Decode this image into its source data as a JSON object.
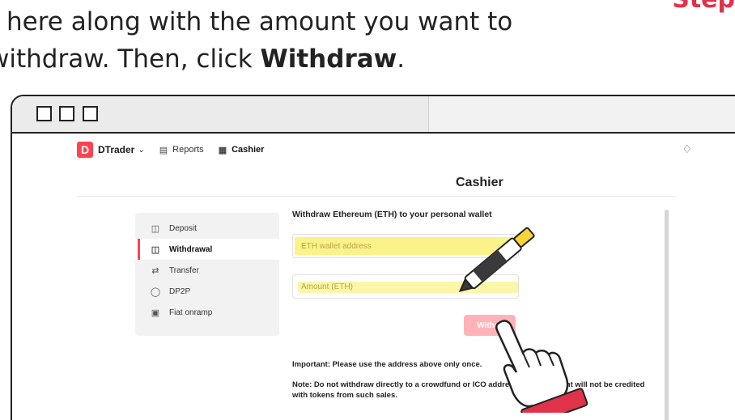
{
  "instruction": {
    "line1": "t here along with the amount you want to",
    "line2_prefix": "withdraw. Then, click ",
    "line2_bold": "Withdraw",
    "line2_suffix": ".",
    "step_tag": "Step"
  },
  "appbar": {
    "logo_glyph": "D",
    "brand": "DTrader",
    "reports_label": "Reports",
    "cashier_label": "Cashier"
  },
  "page": {
    "title": "Cashier"
  },
  "sidebar": {
    "items": [
      {
        "label": "Deposit",
        "icon": "deposit-icon"
      },
      {
        "label": "Withdrawal",
        "icon": "withdrawal-icon"
      },
      {
        "label": "Transfer",
        "icon": "transfer-icon"
      },
      {
        "label": "DP2P",
        "icon": "dp2p-icon"
      },
      {
        "label": "Fiat onramp",
        "icon": "fiat-onramp-icon"
      }
    ]
  },
  "form": {
    "title": "Withdraw Ethereum (ETH) to your personal wallet",
    "address_placeholder": "ETH wallet address",
    "amount_placeholder": "Amount (ETH)",
    "withdraw_label": "Withdr"
  },
  "notes": {
    "important": "Important: Please use the address above only once.",
    "note_start": "Note: Do not withdraw directly to a crowdfund or ICO address, ",
    "note_mid": "unt will not be credited",
    "note_end": "with tokens from such sales."
  },
  "colors": {
    "accent": "#ff444f",
    "highlight": "#fbf28a",
    "step_red": "#e0334b"
  }
}
